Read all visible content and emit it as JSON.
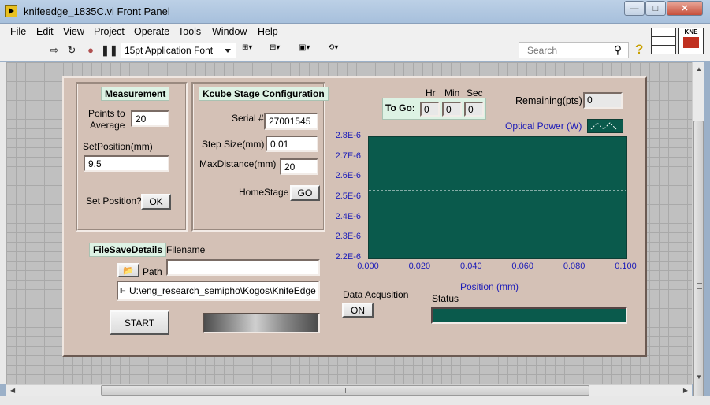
{
  "window": {
    "title": "knifeedge_1835C.vi Front Panel",
    "controls": {
      "minimize": "—",
      "maximize": "□",
      "close": "✕"
    }
  },
  "menu": [
    "File",
    "Edit",
    "View",
    "Project",
    "Operate",
    "Tools",
    "Window",
    "Help"
  ],
  "toolbar": {
    "font": "15pt Application Font",
    "search_placeholder": "Search",
    "vi_icon_text": "KNE"
  },
  "measurement": {
    "header": "Measurement",
    "points_label_1": "Points to",
    "points_label_2": "Average",
    "points_value": "20",
    "setpos_label": "SetPosition(mm)",
    "setpos_value": "9.5",
    "setpos_q_label": "Set Position?",
    "ok_label": "OK"
  },
  "kcube": {
    "header": "Kcube Stage Configuration",
    "serial_label": "Serial #",
    "serial_value": "27001545",
    "step_label": "Step Size(mm)",
    "step_value": "0.01",
    "maxdist_label": "MaxDistance(mm)",
    "maxdist_value": "20",
    "home_label": "HomeStage",
    "go_label": "GO"
  },
  "filesave": {
    "header": "FileSaveDetails",
    "filename_label": "Filename",
    "filename_value": "",
    "path_label": "Path",
    "path_value": "U:\\eng_research_semipho\\Kogos\\KnifeEdge"
  },
  "controls": {
    "start_label": "START",
    "acq_label": "Data Acqusition",
    "acq_button": "ON",
    "status_label": "Status"
  },
  "timer": {
    "to_go_label": "To Go:",
    "hr_label": "Hr",
    "min_label": "Min",
    "sec_label": "Sec",
    "hr": "0",
    "min": "0",
    "sec": "0",
    "remaining_label": "Remaining(pts)",
    "remaining": "0"
  },
  "chart_data": {
    "type": "line",
    "xlabel": "Position (mm)",
    "ylabel": "",
    "legend": "Optical Power (W)",
    "xlim": [
      0,
      0.1
    ],
    "ylim": [
      2.2e-06,
      2.8e-06
    ],
    "x_ticks": [
      "0.000",
      "0.020",
      "0.040",
      "0.060",
      "0.080",
      "0.100"
    ],
    "y_ticks": [
      "2.8E-6",
      "2.7E-6",
      "2.6E-6",
      "2.5E-6",
      "2.4E-6",
      "2.3E-6",
      "2.2E-6"
    ],
    "series": [
      {
        "name": "Optical Power (W)",
        "x": [
          0,
          0.1
        ],
        "y": [
          2.535e-06,
          2.535e-06
        ],
        "style": "dashed",
        "color": "#ffffff"
      }
    ],
    "background": "#0a5a4c"
  }
}
